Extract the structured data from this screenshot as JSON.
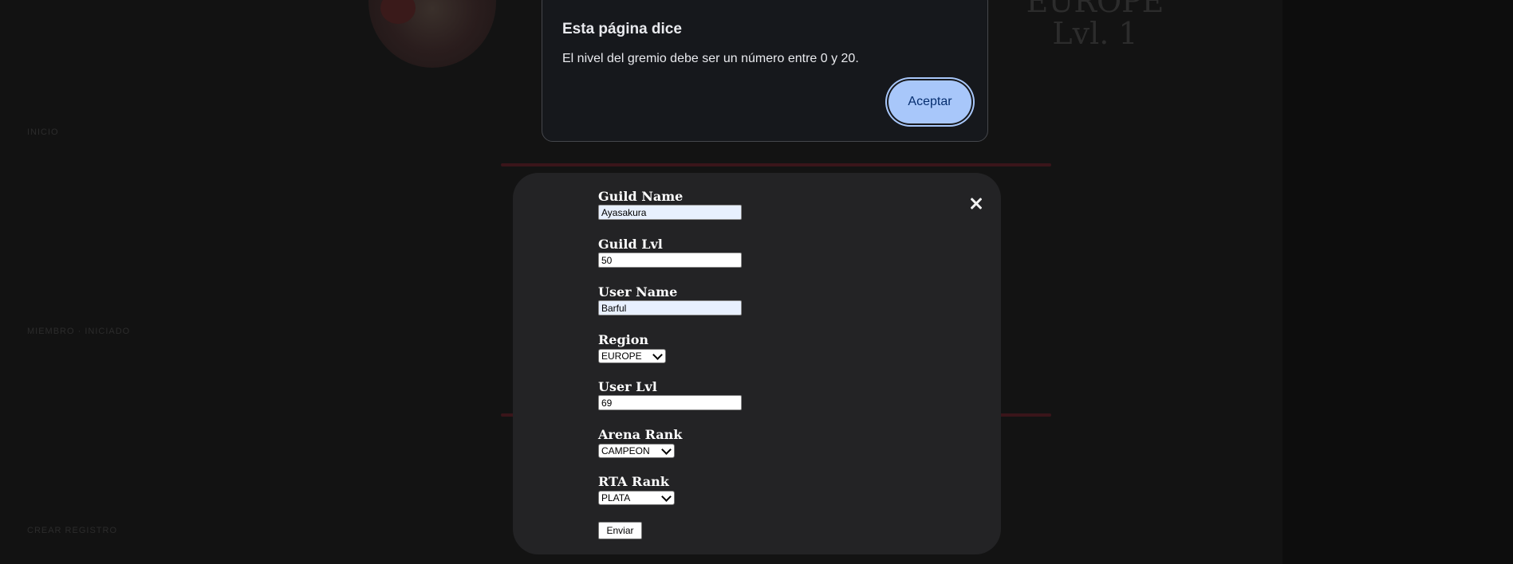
{
  "background_page": {
    "sidebar_links": [
      "INICIO",
      "MIEMBRO · INICIADO",
      "CREAR REGISTRO"
    ],
    "header_title_line1": "EUROPE",
    "header_title_line2": "Lvl. 1"
  },
  "dialog": {
    "title": "Esta página dice",
    "message": "El nivel del gremio debe ser un número entre 0 y 20.",
    "accept_label": "Aceptar"
  },
  "form": {
    "close_icon": "close-icon",
    "guild_name": {
      "label": "Guild Name",
      "value": "Ayasakura"
    },
    "guild_lvl": {
      "label": "Guild Lvl",
      "value": "50"
    },
    "user_name": {
      "label": "User Name",
      "value": "Barful"
    },
    "region": {
      "label": "Region",
      "value": "EUROPE"
    },
    "user_lvl": {
      "label": "User Lvl",
      "value": "69"
    },
    "arena_rank": {
      "label": "Arena Rank",
      "value": "CAMPEON"
    },
    "rta_rank": {
      "label": "RTA Rank",
      "value": "PLATA"
    },
    "submit_label": "Enviar"
  },
  "colors": {
    "dialog_bg": "#16181c",
    "accent": "#a8c7fa",
    "modal_bg": "#232325"
  }
}
